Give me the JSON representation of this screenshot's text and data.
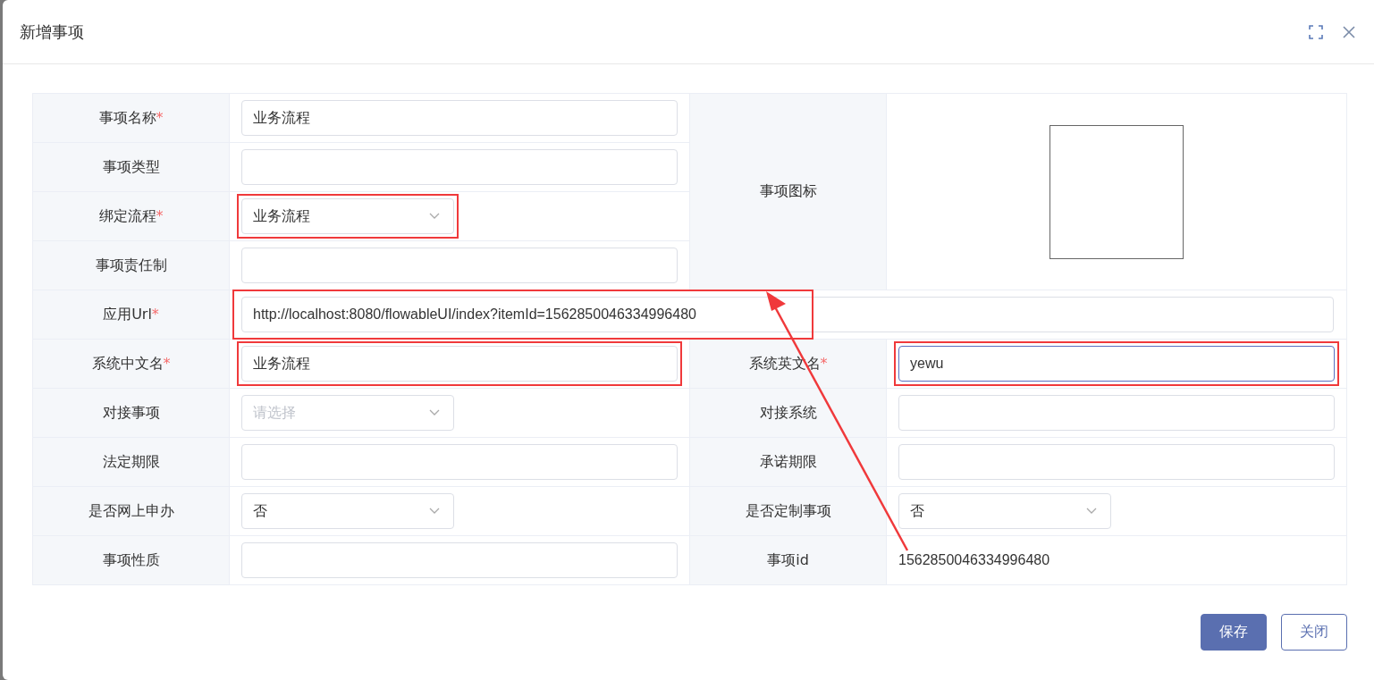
{
  "dialog": {
    "title": "新增事项"
  },
  "top": {
    "left": [
      {
        "label": "事项名称",
        "mark": "*",
        "field": {
          "kind": "input",
          "value": "业务流程"
        }
      },
      {
        "label": "事项类型",
        "field": {
          "kind": "input"
        }
      },
      {
        "label": "绑定流程",
        "mark": "*",
        "field": {
          "kind": "select",
          "value": "业务流程",
          "highlighted": true
        }
      },
      {
        "label": "事项责任制",
        "field": {
          "kind": "input"
        }
      }
    ],
    "right": {
      "label": "事项图标",
      "field": {
        "kind": "image"
      }
    }
  },
  "url": {
    "label": "应用Url",
    "mark": "*",
    "field": {
      "kind": "input",
      "value": "http://localhost:8080/flowableUI/index?itemId=1562850046334996480",
      "highlighted": true
    }
  },
  "pairs": [
    [
      {
        "label": "系统中文名",
        "mark": "*",
        "field": {
          "kind": "input",
          "value": "业务流程",
          "highlighted": true
        }
      },
      {
        "label": "系统英文名",
        "mark": "*",
        "field": {
          "kind": "input",
          "value": "yewu",
          "highlighted": true,
          "focused": true
        }
      }
    ],
    [
      {
        "label": "对接事项",
        "field": {
          "kind": "select",
          "placeholder": "请选择"
        }
      },
      {
        "label": "对接系统",
        "field": {
          "kind": "input"
        }
      }
    ],
    [
      {
        "label": "法定期限",
        "field": {
          "kind": "input"
        }
      },
      {
        "label": "承诺期限",
        "field": {
          "kind": "input"
        }
      }
    ],
    [
      {
        "label": "是否网上申办",
        "field": {
          "kind": "select",
          "value": "否"
        }
      },
      {
        "label": "是否定制事项",
        "field": {
          "kind": "select",
          "value": "否"
        }
      }
    ],
    [
      {
        "label": "事项性质",
        "field": {
          "kind": "input"
        }
      },
      {
        "label": "事项id",
        "field": {
          "kind": "text",
          "value": "1562850046334996480"
        }
      }
    ]
  ],
  "buttons": [
    {
      "label": "保存",
      "kind": "primary"
    },
    {
      "label": "关闭",
      "kind": "plain"
    }
  ]
}
